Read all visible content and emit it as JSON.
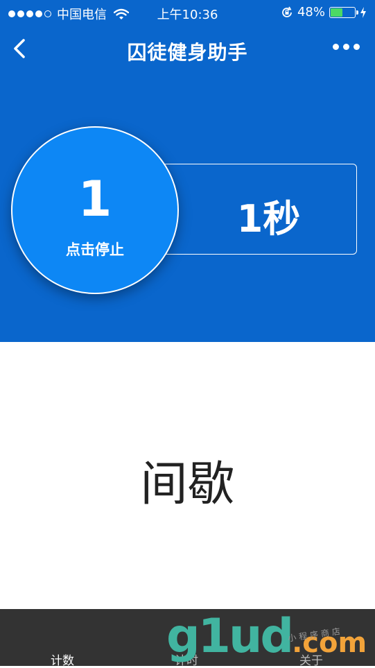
{
  "status_bar": {
    "carrier": "中国电信",
    "time": "上午10:36",
    "battery_percent_text": "48%",
    "battery_level": 0.48
  },
  "nav": {
    "title": "囚徒健身助手"
  },
  "counter": {
    "count": "1",
    "action_label": "点击停止"
  },
  "timer": {
    "value": "1秒"
  },
  "phase_label": "间歇",
  "tabs": [
    {
      "label": "计数"
    },
    {
      "label": "计时"
    },
    {
      "label": "关于"
    }
  ],
  "watermark": {
    "logo": "g1ud",
    "suffix": ".com",
    "tagline": "小程序商店"
  },
  "colors": {
    "header_bg": "#0a66cc",
    "circle_bg": "#0d87f5",
    "tabbar_bg": "#333333"
  }
}
